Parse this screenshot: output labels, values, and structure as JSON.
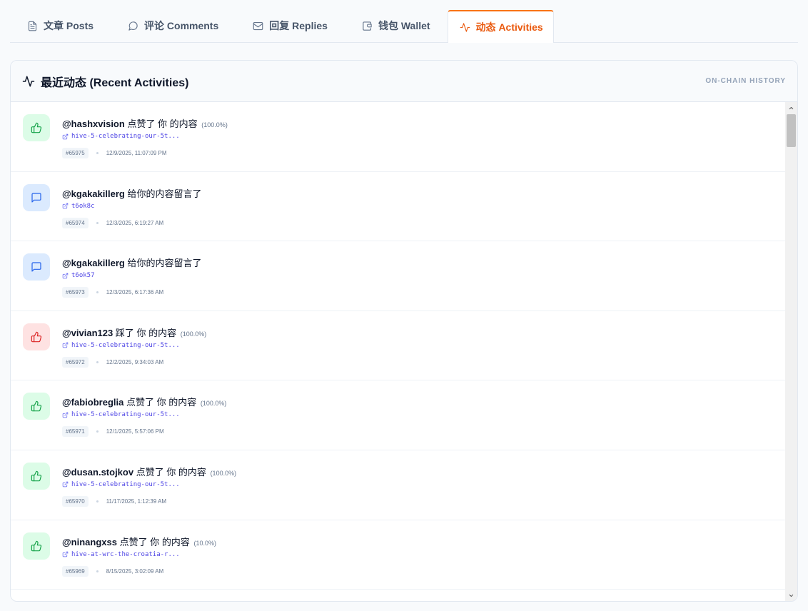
{
  "tabs": [
    {
      "label": "文章 Posts",
      "icon": "document-icon"
    },
    {
      "label": "评论 Comments",
      "icon": "speech-bubble-icon"
    },
    {
      "label": "回复 Replies",
      "icon": "envelope-icon"
    },
    {
      "label": "钱包 Wallet",
      "icon": "wallet-icon"
    },
    {
      "label": "动态 Activities",
      "icon": "activity-icon",
      "active": true
    }
  ],
  "panel": {
    "title": "最近动态 (Recent Activities)",
    "subtitle": "ON-CHAIN HISTORY"
  },
  "activities": [
    {
      "type": "upvote",
      "user": "@hashxvision",
      "action": " 点赞了 你 的内容",
      "pct": "(100.0%)",
      "link": "hive-5-celebrating-our-5t...",
      "id": "#65975",
      "time": "12/9/2025, 11:07:09 PM"
    },
    {
      "type": "comment",
      "user": "@kgakakillerg",
      "action": " 给你的内容留言了",
      "pct": "",
      "link": "t6ok8c",
      "id": "#65974",
      "time": "12/3/2025, 6:19:27 AM"
    },
    {
      "type": "comment",
      "user": "@kgakakillerg",
      "action": " 给你的内容留言了",
      "pct": "",
      "link": "t6ok57",
      "id": "#65973",
      "time": "12/3/2025, 6:17:36 AM"
    },
    {
      "type": "downvote",
      "user": "@vivian123",
      "action": " 踩了 你 的内容",
      "pct": "(100.0%)",
      "link": "hive-5-celebrating-our-5t...",
      "id": "#65972",
      "time": "12/2/2025, 9:34:03 AM"
    },
    {
      "type": "upvote",
      "user": "@fabiobreglia",
      "action": " 点赞了 你 的内容",
      "pct": "(100.0%)",
      "link": "hive-5-celebrating-our-5t...",
      "id": "#65971",
      "time": "12/1/2025, 5:57:06 PM"
    },
    {
      "type": "upvote",
      "user": "@dusan.stojkov",
      "action": " 点赞了 你 的内容",
      "pct": "(100.0%)",
      "link": "hive-5-celebrating-our-5t...",
      "id": "#65970",
      "time": "11/17/2025, 1:12:39 AM"
    },
    {
      "type": "upvote",
      "user": "@ninangxss",
      "action": " 点赞了 你 的内容",
      "pct": "(10.0%)",
      "link": "hive-at-wrc-the-croatia-r...",
      "id": "#65969",
      "time": "8/15/2025, 3:02:09 AM"
    }
  ]
}
